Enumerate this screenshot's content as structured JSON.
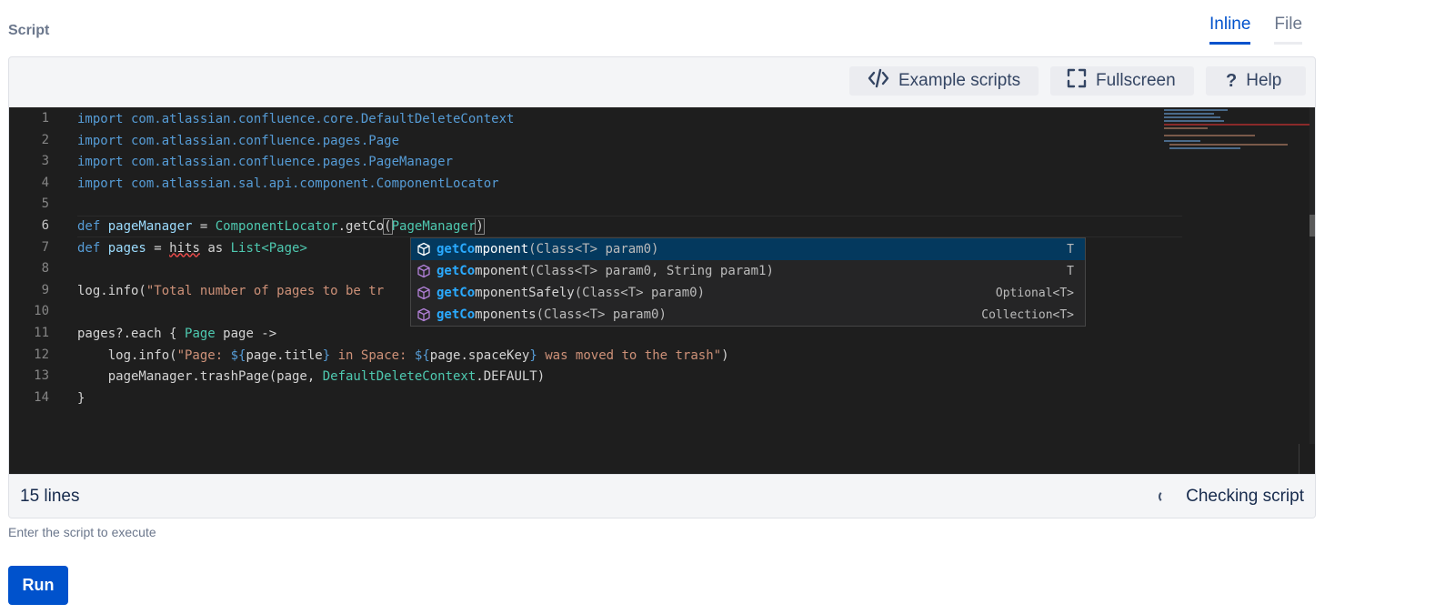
{
  "script_label": "Script",
  "mode_tabs": {
    "inline": "Inline",
    "file": "File",
    "active": "Inline"
  },
  "toolbar": {
    "example_label": "Example scripts",
    "example_icon": "code-icon",
    "fullscreen_label": "Fullscreen",
    "fullscreen_icon": "fullscreen-icon",
    "help_label": "Help",
    "help_icon": "question-icon"
  },
  "editor": {
    "line_numbers": [
      "1",
      "2",
      "3",
      "4",
      "5",
      "6",
      "7",
      "8",
      "9",
      "10",
      "11",
      "12",
      "13",
      "14"
    ],
    "current_line": "6",
    "lines": [
      [
        {
          "t": "import com.atlassian.confluence.core.DefaultDeleteContext",
          "c": "kw"
        }
      ],
      [
        {
          "t": "import com.atlassian.confluence.pages.Page",
          "c": "kw"
        }
      ],
      [
        {
          "t": "import com.atlassian.confluence.pages.PageManager",
          "c": "kw"
        }
      ],
      [
        {
          "t": "import com.atlassian.sal.api.component.ComponentLocator",
          "c": "kw"
        }
      ],
      [],
      [
        {
          "t": "def ",
          "c": "kw"
        },
        {
          "t": "pageManager",
          "c": "var"
        },
        {
          "t": " = "
        },
        {
          "t": "ComponentLocator",
          "c": "ty"
        },
        {
          "t": ".getCo"
        },
        {
          "t": "(",
          "c": "br"
        },
        {
          "t": "PageManager",
          "c": "ty"
        },
        {
          "t": ")",
          "c": "br"
        }
      ],
      [
        {
          "t": "def ",
          "c": "kw"
        },
        {
          "t": "pages",
          "c": "var"
        },
        {
          "t": " = "
        },
        {
          "t": "hits",
          "c": "squig"
        },
        {
          "t": " as "
        },
        {
          "t": "List<Page>",
          "c": "ty"
        }
      ],
      [],
      [
        {
          "t": "log.info("
        },
        {
          "t": "\"Total number of pages to be tr",
          "c": "str"
        }
      ],
      [],
      [
        {
          "t": "pages?.each { "
        },
        {
          "t": "Page",
          "c": "ty"
        },
        {
          "t": " page ->"
        }
      ],
      [
        {
          "t": "    log.info("
        },
        {
          "t": "\"Page: ",
          "c": "str"
        },
        {
          "t": "${",
          "c": "kw"
        },
        {
          "t": "page.title"
        },
        {
          "t": "}",
          "c": "kw"
        },
        {
          "t": " in Space: ",
          "c": "str"
        },
        {
          "t": "${",
          "c": "kw"
        },
        {
          "t": "page.spaceKey"
        },
        {
          "t": "}",
          "c": "kw"
        },
        {
          "t": " was moved to the trash\"",
          "c": "str"
        },
        {
          "t": ")"
        }
      ],
      [
        {
          "t": "    pageManager.trashPage(page, "
        },
        {
          "t": "DefaultDeleteContext",
          "c": "ty"
        },
        {
          "t": ".DEFAULT)"
        }
      ],
      [
        {
          "t": "}"
        }
      ]
    ]
  },
  "suggestions": [
    {
      "match": "getCo",
      "rest": "mponent",
      "params": "(Class<T> param0)",
      "type": "T",
      "selected": true
    },
    {
      "match": "getCo",
      "rest": "mponent",
      "params": "(Class<T> param0, String param1)",
      "type": "T",
      "selected": false
    },
    {
      "match": "getCo",
      "rest": "mponentSafely",
      "params": "(Class<T> param0)",
      "type": "Optional<T>",
      "selected": false
    },
    {
      "match": "getCo",
      "rest": "mponents",
      "params": "(Class<T> param0)",
      "type": "Collection<T>",
      "selected": false
    }
  ],
  "status": {
    "lines_count": "15 lines",
    "checking": "Checking script"
  },
  "helper_text": "Enter the script to execute",
  "run_label": "Run",
  "colors": {
    "accent": "#0052cc",
    "editor_bg": "#1e1e1e",
    "suggest_selected": "#04395e"
  }
}
